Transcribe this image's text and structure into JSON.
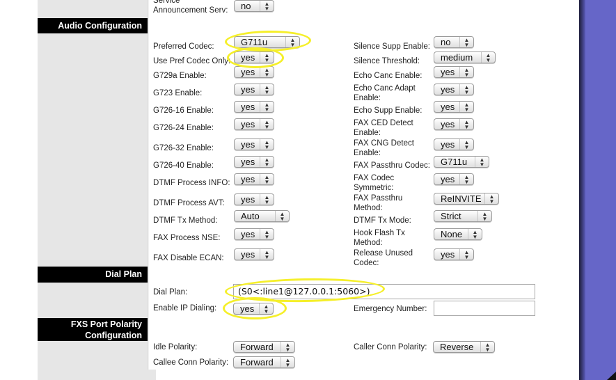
{
  "colors": {
    "sidebar_bg": "#e6e6e6",
    "section_header_bg": "#000000",
    "right_panel": "#6666c8",
    "highlight_ring": "#f5ef2a"
  },
  "top_row": {
    "label_line1": "Service",
    "label_line2": "Announcement Serv:",
    "value": "no"
  },
  "sections": {
    "audio": "Audio Configuration",
    "dial_plan": "Dial Plan",
    "fxs_line1": "FXS Port Polarity",
    "fxs_line2": "Configuration"
  },
  "audio_left": [
    {
      "label": "Preferred Codec:",
      "value": "G711u"
    },
    {
      "label": "Use Pref Codec Only:",
      "value": "yes"
    },
    {
      "label": "G729a Enable:",
      "value": "yes"
    },
    {
      "label": "G723 Enable:",
      "value": "yes"
    },
    {
      "label": "G726-16 Enable:",
      "value": "yes"
    },
    {
      "label": "G726-24 Enable:",
      "value": "yes"
    },
    {
      "label": "G726-32 Enable:",
      "value": "yes"
    },
    {
      "label": "G726-40 Enable:",
      "value": "yes"
    },
    {
      "label": "DTMF Process INFO:",
      "value": "yes"
    },
    {
      "label": "DTMF Process AVT:",
      "value": "yes"
    },
    {
      "label": "DTMF Tx Method:",
      "value": "Auto"
    },
    {
      "label": "FAX Process NSE:",
      "value": "yes"
    },
    {
      "label": "FAX Disable ECAN:",
      "value": "yes"
    }
  ],
  "audio_right": [
    {
      "label": "Silence Supp Enable:",
      "value": "no"
    },
    {
      "label": "Silence Threshold:",
      "value": "medium"
    },
    {
      "label": "Echo Canc Enable:",
      "value": "yes"
    },
    {
      "label": "Echo Canc Adapt",
      "label2": "Enable:",
      "value": "yes"
    },
    {
      "label": "Echo Supp Enable:",
      "value": "yes"
    },
    {
      "label": "FAX CED Detect",
      "label2": "Enable:",
      "value": "yes"
    },
    {
      "label": "FAX CNG Detect",
      "label2": "Enable:",
      "value": "yes"
    },
    {
      "label": "FAX Passthru Codec:",
      "value": "G711u"
    },
    {
      "label": "FAX Codec",
      "label2": "Symmetric:",
      "value": "yes"
    },
    {
      "label": "FAX Passthru",
      "label2": "Method:",
      "value": "ReINVITE"
    },
    {
      "label": "DTMF Tx Mode:",
      "value": "Strict"
    },
    {
      "label": "Hook Flash Tx",
      "label2": "Method:",
      "value": "None"
    },
    {
      "label": "Release Unused",
      "label2": "Codec:",
      "value": "yes"
    }
  ],
  "dial_plan": {
    "label": "Dial Plan:",
    "value": "(S0<:line1@127.0.0.1:5060>)",
    "ip_dialing_label": "Enable IP Dialing:",
    "ip_dialing_value": "yes",
    "emergency_label": "Emergency Number:",
    "emergency_value": ""
  },
  "fxs": {
    "idle_label": "Idle Polarity:",
    "idle_value": "Forward",
    "caller_label": "Caller Conn Polarity:",
    "caller_value": "Reverse",
    "callee_label": "Callee Conn Polarity:",
    "callee_value": "Forward"
  },
  "icons": {
    "select_arrows": "▲▼"
  }
}
